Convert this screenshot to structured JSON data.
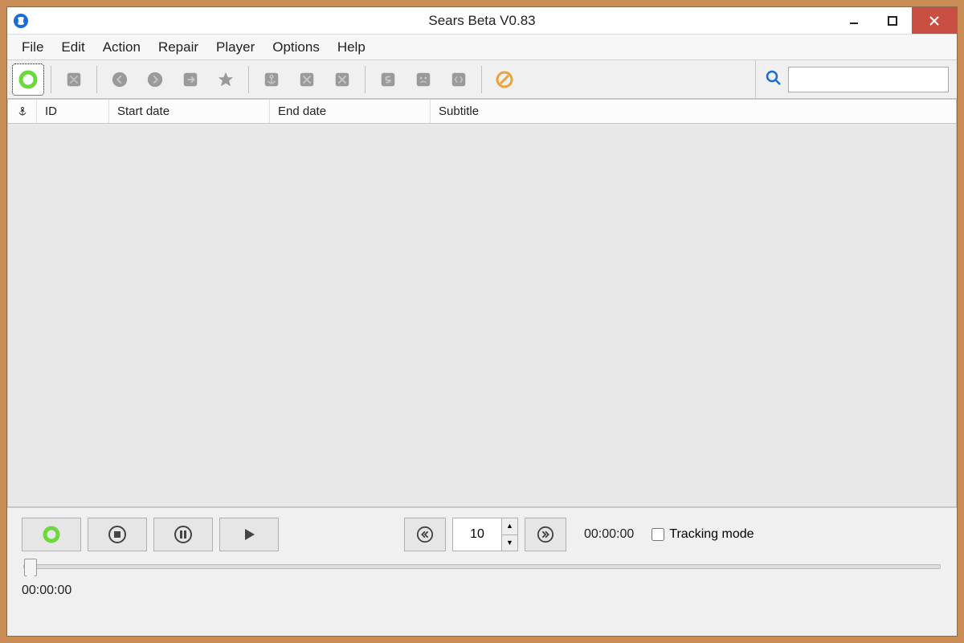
{
  "window": {
    "title": "Sears Beta V0.83"
  },
  "menu": {
    "items": [
      "File",
      "Edit",
      "Action",
      "Repair",
      "Player",
      "Options",
      "Help"
    ]
  },
  "toolbar": {
    "search_value": ""
  },
  "table": {
    "columns": {
      "anchor": "",
      "id": "ID",
      "start": "Start date",
      "end": "End date",
      "subtitle": "Subtitle"
    },
    "rows": []
  },
  "player": {
    "step_value": "10",
    "current_time": "00:00:00",
    "elapsed_time": "00:00:00",
    "tracking_label": "Tracking mode",
    "tracking_checked": false
  }
}
